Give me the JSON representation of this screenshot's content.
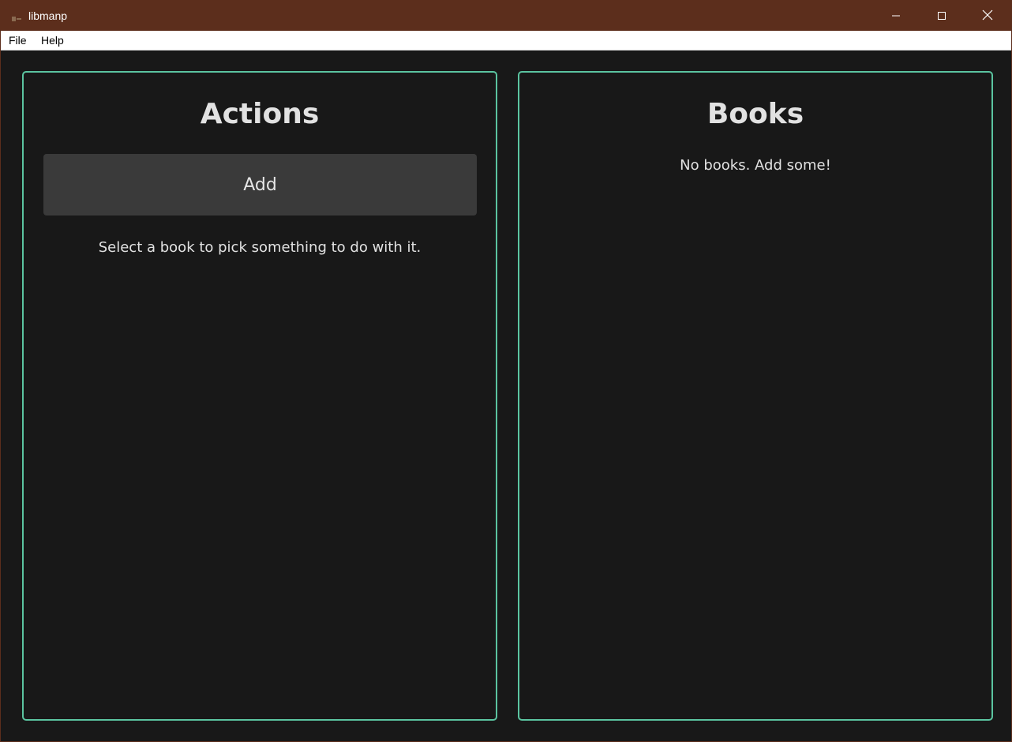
{
  "window": {
    "title": "libmanp",
    "icon": "app-icon",
    "titlebar_color": "#5c2e1c",
    "controls": [
      "minimize-icon",
      "maximize-icon",
      "close-icon"
    ]
  },
  "menubar": {
    "items": [
      {
        "label": "File"
      },
      {
        "label": "Help"
      }
    ]
  },
  "actions_panel": {
    "title": "Actions",
    "add_button_label": "Add",
    "hint": "Select a book to pick something to do with it."
  },
  "books_panel": {
    "title": "Books",
    "empty_message": "No books. Add some!"
  },
  "colors": {
    "accent": "#5bc4a0",
    "background": "#181818",
    "button": "#3a3a3a",
    "text": "#e2e2e2"
  }
}
